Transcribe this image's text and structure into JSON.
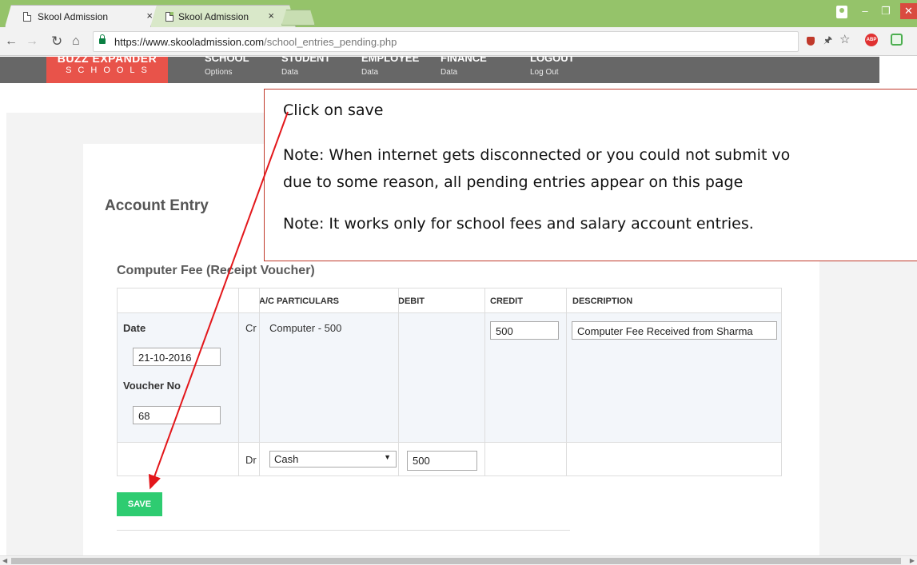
{
  "browser": {
    "tabs": [
      {
        "title": "Skool Admission",
        "active": true
      },
      {
        "title": "Skool Admission",
        "active": false
      }
    ],
    "tab_close_glyph": "×",
    "url_host": "https://www.skooladmission.com",
    "url_path": "/school_entries_pending.php",
    "icons": {
      "back": "arrow-left-icon",
      "forward": "arrow-right-icon",
      "reload": "reload-icon",
      "home": "home-icon",
      "lock": "lock-icon",
      "star": "star-icon",
      "abp": "adblock-icon"
    },
    "abp_label": "ABP"
  },
  "site": {
    "brand_name": "BUZZ EXPANDER",
    "brand_sub": "SCHOOLS",
    "nav": [
      {
        "label": "SCHOOL",
        "sub": "Options"
      },
      {
        "label": "STUDENT",
        "sub": "Data"
      },
      {
        "label": "EMPLOYEE",
        "sub": "Data"
      },
      {
        "label": "FINANCE",
        "sub": "Data"
      },
      {
        "label": "LOGOUT",
        "sub": "Log Out"
      }
    ],
    "brand_color": "#e8534a",
    "nav_color": "#676767"
  },
  "page": {
    "heading": "Account Entry",
    "voucher_heading": "Computer Fee (Receipt Voucher)",
    "table": {
      "headers": {
        "particulars": "A/C PARTICULARS",
        "debit": "DEBIT",
        "credit": "CREDIT",
        "description": "DESCRIPTION"
      },
      "date_label": "Date",
      "date_value": "21-10-2016",
      "voucher_label": "Voucher No",
      "voucher_value": "68",
      "credit_row": {
        "type": "Cr",
        "particulars": "Computer - 500",
        "credit": "500",
        "description": "Computer Fee Received from Sharma"
      },
      "debit_row": {
        "type": "Dr",
        "account": "Cash",
        "debit": "500"
      }
    },
    "save_label": "SAVE",
    "save_color": "#2ecc71"
  },
  "annotation": {
    "line1": "Click on save",
    "line2": "Note: When internet gets disconnected or you could not submit vo",
    "line3": "due to some reason, all pending entries appear on this page",
    "line4": "Note: It works only for school fees and salary account entries.",
    "color": "#e3171b"
  }
}
